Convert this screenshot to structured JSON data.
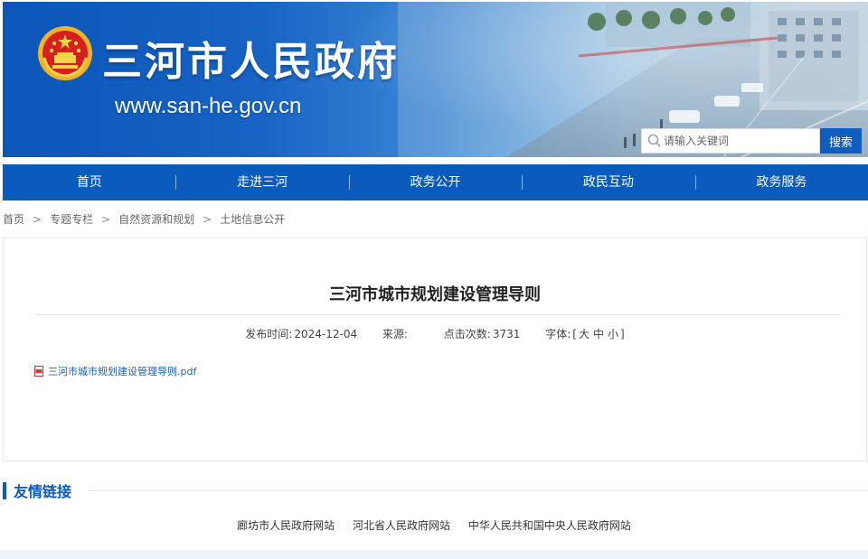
{
  "header": {
    "site_title": "三河市人民政府",
    "site_url": "www.san-he.gov.cn",
    "search": {
      "placeholder": "请输入关键词",
      "button_label": "搜索"
    },
    "colors": {
      "brand": "#0b5bbf"
    }
  },
  "nav": {
    "items": [
      {
        "label": "首页"
      },
      {
        "label": "走进三河"
      },
      {
        "label": "政务公开"
      },
      {
        "label": "政民互动"
      },
      {
        "label": "政务服务"
      }
    ]
  },
  "breadcrumb": {
    "items": [
      {
        "label": "首页"
      },
      {
        "label": "专题专栏"
      },
      {
        "label": "自然资源和规划"
      },
      {
        "label": "土地信息公开"
      }
    ],
    "separator": ">"
  },
  "article": {
    "title": "三河市城市规划建设管理导则",
    "meta": {
      "publish_label": "发布时间:",
      "publish_date": "2024-12-04",
      "source_label": "来源:",
      "source_value": "",
      "clicks_label": "点击次数:",
      "clicks_value": "3731",
      "font_label": "字体:",
      "font_open": "[",
      "font_large": "大",
      "font_medium": "中",
      "font_small": "小",
      "font_close": "]"
    },
    "attachment": {
      "icon": "pdf-icon",
      "filename": "三河市城市规划建设管理导则.pdf"
    }
  },
  "links": {
    "title": "友情链接",
    "items": [
      {
        "label": "廊坊市人民政府网站"
      },
      {
        "label": "河北省人民政府网站"
      },
      {
        "label": "中华人民共和国中央人民政府网站"
      }
    ]
  }
}
